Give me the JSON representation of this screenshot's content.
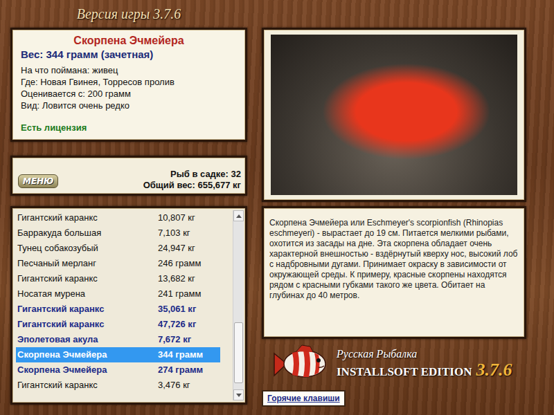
{
  "window": {
    "title": "Версия игры 3.7.6"
  },
  "fish": {
    "name": "Скорпена Эчмейера",
    "weight": "Вес: 344 грамм (зачетная)",
    "details": [
      "На что поймана: живец",
      "Где: Новая Гвинея, Торресов пролив",
      "Оценивается с: 200 грамм",
      "Вид: Ловится очень редко"
    ],
    "license": "Есть лицензия"
  },
  "menu_button": "МЕНЮ",
  "keepnet": {
    "count": "Рыб в садке: 32",
    "total": "Общий вес: 655,677 кг"
  },
  "catch_list": {
    "scroll_level": 0.94,
    "rows": [
      {
        "name": "Гигантский каранкс",
        "weight": "10,807 кг",
        "trophy": false,
        "selected": false
      },
      {
        "name": "Барракуда большая",
        "weight": "7,103 кг",
        "trophy": false,
        "selected": false
      },
      {
        "name": "Тунец собакозубый",
        "weight": "24,947 кг",
        "trophy": false,
        "selected": false
      },
      {
        "name": "Песчаный мерланг",
        "weight": "246 грамм",
        "trophy": false,
        "selected": false
      },
      {
        "name": "Гигантский каранкс",
        "weight": "13,682 кг",
        "trophy": false,
        "selected": false
      },
      {
        "name": "Носатая мурена",
        "weight": "241 грамм",
        "trophy": false,
        "selected": false
      },
      {
        "name": "Гигантский каранкс",
        "weight": "35,061 кг",
        "trophy": true,
        "selected": false
      },
      {
        "name": "Гигантский каранкс",
        "weight": "47,726 кг",
        "trophy": true,
        "selected": false
      },
      {
        "name": "Эполетовая акула",
        "weight": "7,672 кг",
        "trophy": true,
        "selected": false
      },
      {
        "name": "Скорпена Эчмейера",
        "weight": "344 грамм",
        "trophy": true,
        "selected": true
      },
      {
        "name": "Скорпена Эчмейера",
        "weight": "274 грамм",
        "trophy": true,
        "selected": false
      },
      {
        "name": "Гигантский каранкс",
        "weight": "3,476 кг",
        "trophy": false,
        "selected": false
      }
    ]
  },
  "description": "Скорпена Эчмейера или Eschmeyer's scorpionfish (Rhinopias eschmeyeri) - вырастает до 19 см. Питается мелкими рыбами, охотится из засады на дне. Эта скорпена обладает очень характерной внешностью - вздёрнутый кверху нос, высокий лоб с надбровными дугами. Принимает окраску в зависимости от окружающей среды. К примеру, красные скорпены находятся рядом с красными губками такого же цвета. Обитает на глубинах до 40 метров.",
  "logo": {
    "title": "Русская Рыбалка",
    "edition": "INSTALLSOFT EDITION",
    "version": "3.7.6"
  },
  "hotkeys_button": "Горячие клавиши"
}
